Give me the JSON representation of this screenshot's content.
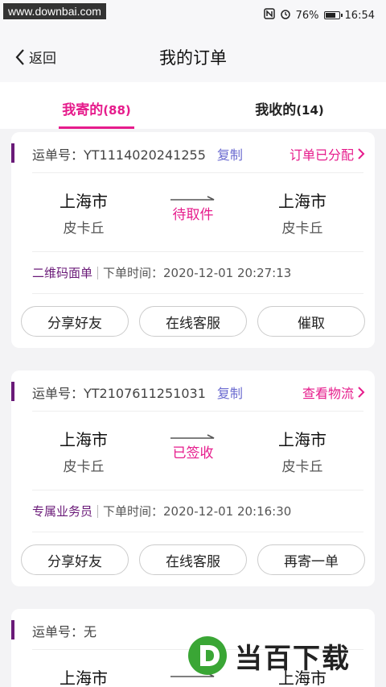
{
  "status_bar": {
    "watermark": "www.downbai.com",
    "battery": "76%",
    "battery_level": 0.76,
    "time": "16:54"
  },
  "nav": {
    "back_label": "返回",
    "title": "我的订单"
  },
  "tabs": [
    {
      "label": "我寄的",
      "count": "(88)",
      "active": true
    },
    {
      "label": "我收的",
      "count": "(14)",
      "active": false
    }
  ],
  "orders": [
    {
      "waybill": "运单号：YT1114020241255",
      "copy": "复制",
      "link_status": "订单已分配",
      "from_city": "上海市",
      "from_district": "皮卡丘",
      "state": "待取件",
      "to_city": "上海市",
      "to_district": "皮卡丘",
      "tag": "二维码面单",
      "order_time": "下单时间：2020-12-01 20:27:13",
      "buttons": [
        "分享好友",
        "在线客服",
        "催取"
      ]
    },
    {
      "waybill": "运单号：YT2107611251031",
      "copy": "复制",
      "link_status": "查看物流",
      "from_city": "上海市",
      "from_district": "皮卡丘",
      "state": "已签收",
      "to_city": "上海市",
      "to_district": "皮卡丘",
      "tag": "专属业务员",
      "order_time": "下单时间：2020-12-01 20:16:30",
      "buttons": [
        "分享好友",
        "在线客服",
        "再寄一单"
      ]
    },
    {
      "waybill": "运单号：无",
      "from_city": "上海市",
      "to_city": "上海市"
    }
  ],
  "watermark_logo": "当百下载",
  "colors": {
    "accent": "#e61c8c",
    "purple": "#6a1a78",
    "copy": "#6b6bd0"
  }
}
